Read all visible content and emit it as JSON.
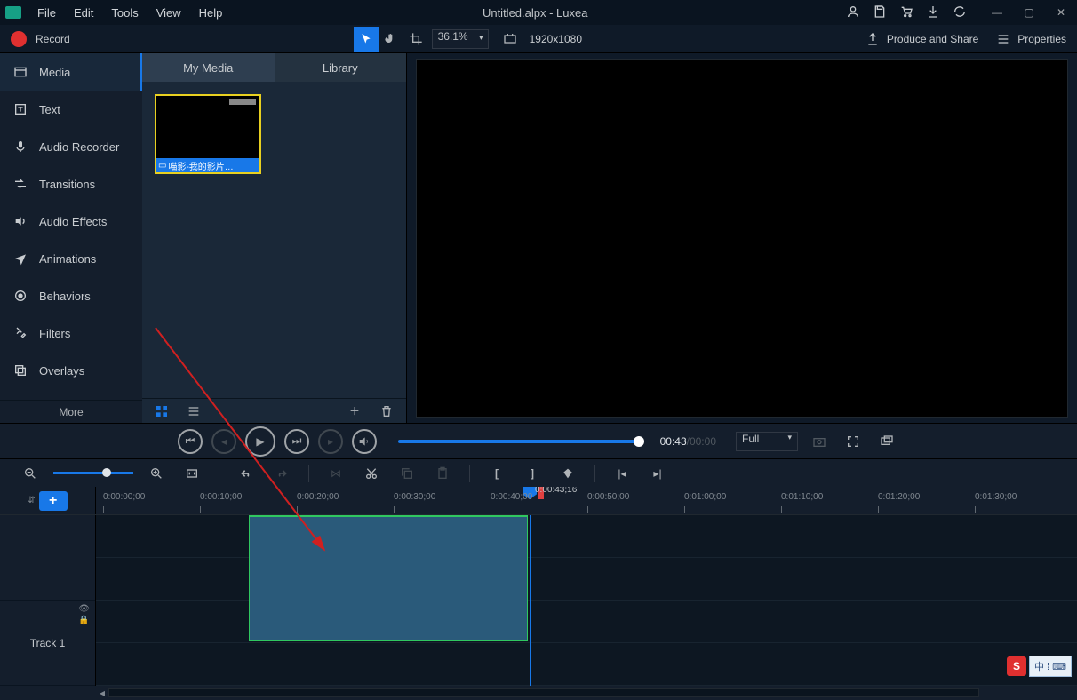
{
  "menu": {
    "file": "File",
    "edit": "Edit",
    "tools": "Tools",
    "view": "View",
    "help": "Help"
  },
  "title": "Untitled.alpx - Luxea",
  "toolbar": {
    "record": "Record",
    "zoom_pct": "36.1%",
    "resolution": "1920x1080",
    "produce": "Produce and Share",
    "properties": "Properties"
  },
  "sidebar": {
    "items": [
      "Media",
      "Text",
      "Audio Recorder",
      "Transitions",
      "Audio Effects",
      "Animations",
      "Behaviors",
      "Filters",
      "Overlays"
    ],
    "more": "More"
  },
  "media_tabs": {
    "my_media": "My Media",
    "library": "Library"
  },
  "clip_name": "喵影-我的影片…",
  "playback": {
    "current": "00:43",
    "duration": "/00:00",
    "view": "Full"
  },
  "timeline": {
    "playhead_time": "0:00:43;16",
    "ticks": [
      "0:00:00;00",
      "0:00:10;00",
      "0:00:20;00",
      "0:00:30;00",
      "0:00:40;00",
      "0:00:50;00",
      "0:01:00;00",
      "0:01:10;00",
      "0:01:20;00",
      "0:01:30;00"
    ],
    "tracks": [
      "Track 1"
    ]
  },
  "colors": {
    "accent": "#1878e8",
    "record": "#e03030",
    "clip_border": "#30c860"
  }
}
